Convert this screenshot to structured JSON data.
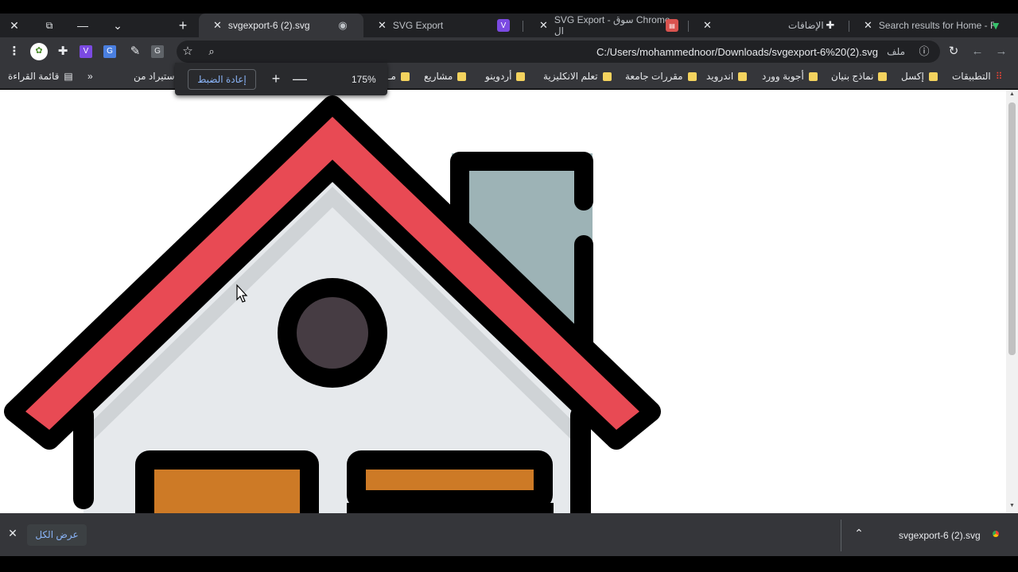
{
  "colors": {
    "roof": "#e84a54",
    "chimney": "#9db3b6",
    "wall": "#e6e9ec",
    "wall_shadow": "#cfd3d6",
    "window_circle": "#463c43",
    "window_rect": "#cd7a26",
    "outline": "#000000"
  },
  "tabs": [
    {
      "label": "svgexport-6 (2).svg",
      "close": "✕",
      "active": true
    },
    {
      "label": "SVG Export",
      "close": "✕",
      "active": false
    },
    {
      "label": "SVG Export - سوق Chrome ال",
      "close": "✕",
      "active": false
    },
    {
      "label": "الإضافات",
      "close": "✕",
      "active": false
    },
    {
      "label": "Search results for Home - Fla",
      "close": "✕",
      "active": false
    }
  ],
  "new_tab": "+",
  "window": {
    "close": "✕",
    "restore": "⧉",
    "minimize": "—",
    "dropdown": "⌄"
  },
  "toolbar": {
    "url": "C:/Users/mohammednoor/Downloads/svgexport-6%20(2).svg",
    "info_label": "ملف",
    "reload_icon": "reload-icon",
    "back_icon": "back-arrow-icon",
    "forward_icon": "forward-arrow-icon"
  },
  "bookmarks": {
    "apps_label": "التطبيقات",
    "items": [
      "إكسل",
      "نماذج بنيان",
      "أجوبة وورد",
      "اندرويد",
      "مقررات جامعة",
      "تعلم الانكليزية",
      "أردوينو",
      "مشاريع",
      "مـ"
    ],
    "import_label": "استيراد من IE",
    "more": "»",
    "reading_list": "قائمة القراءة"
  },
  "zoom": {
    "reset_label": "إعادة الضبط",
    "plus": "+",
    "minus": "—",
    "percent": "175%"
  },
  "download": {
    "filename": "svgexport-6 (2).svg",
    "show_all": "عرض الكل",
    "chevron": "⌃",
    "close": "✕"
  }
}
